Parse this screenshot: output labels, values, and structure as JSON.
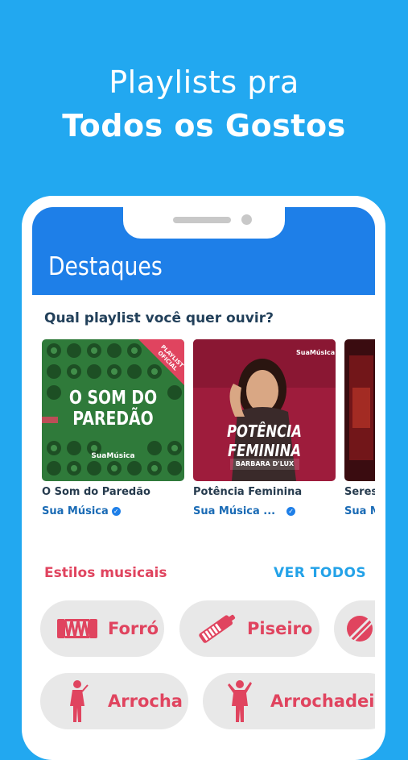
{
  "promo": {
    "line1": "Playlists pra",
    "line2": "Todos os Gostos"
  },
  "appbar": {
    "title": "Destaques"
  },
  "playlists": {
    "heading": "Qual playlist você quer ouvir?",
    "items": [
      {
        "title": "O Som do Paredão",
        "artist": "Sua Música",
        "cover_text_1": "O SOM DO",
        "cover_text_2": "PAREDÃO",
        "ribbon": "PLAYLIST OFICIAL",
        "brand": "SuaMúsica"
      },
      {
        "title": "Potência Feminina",
        "artist": "Sua Música ...",
        "cover_text_1": "POTÊNCIA",
        "cover_text_2": "FEMININA",
        "subtitle": "BARBARA D'LUX",
        "brand": "SuaMúsica"
      },
      {
        "title": "Seres",
        "artist": "Sua M"
      }
    ]
  },
  "estilos": {
    "heading": "Estilos musicais",
    "ver_todos": "VER TODOS",
    "items": [
      {
        "label": "Forró",
        "icon": "accordion-icon"
      },
      {
        "label": "Piseiro",
        "icon": "keytar-icon"
      },
      {
        "label": "",
        "icon": "genre-icon"
      },
      {
        "label": "Arrocha",
        "icon": "singer-icon"
      },
      {
        "label": "Arrochadeir",
        "icon": "dancer-icon"
      }
    ]
  },
  "colors": {
    "background": "#22a8f0",
    "appbar": "#1e7fe8",
    "accent_red": "#e0445f",
    "accent_blue": "#23a2e8"
  }
}
